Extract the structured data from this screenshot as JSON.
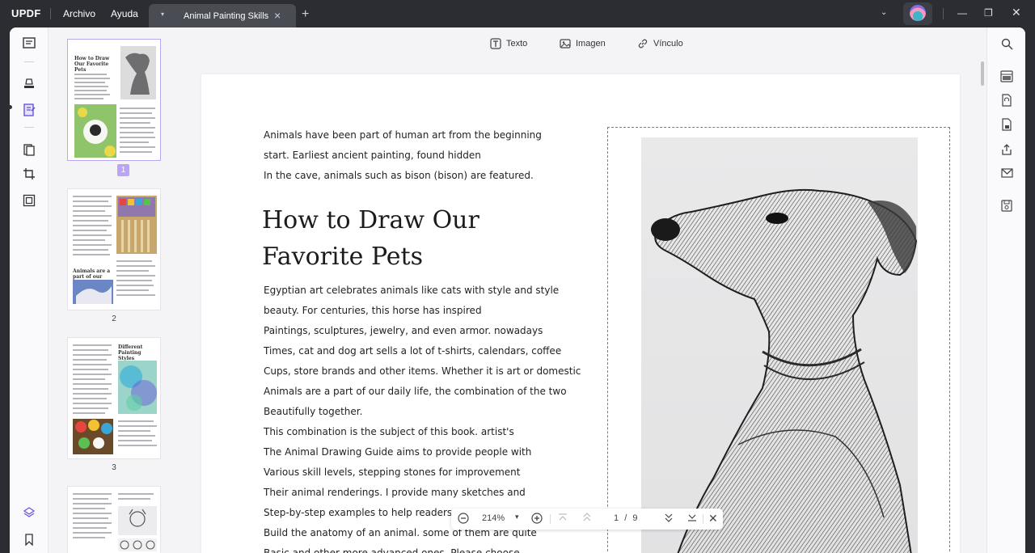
{
  "titlebar": {
    "logo": "UPDF",
    "menus": [
      "Archivo",
      "Ayuda"
    ],
    "tab_title": "Animal Painting Skills"
  },
  "toolbar": {
    "text_label": "Texto",
    "image_label": "Imagen",
    "link_label": "Vínculo"
  },
  "thumbnails": {
    "page1_heading": "How to Draw Our Favorite Pets",
    "page2_heading": "Animals are a part of our daily life",
    "page3_heading": "Different Painting Styles",
    "numbers": [
      "1",
      "2",
      "3"
    ]
  },
  "document": {
    "intro": [
      "Animals have been part of human art from the beginning",
      "start. Earliest ancient painting, found hidden",
      "In the cave, animals such as bison (bison) are featured."
    ],
    "heading_line1": "How to Draw Our",
    "heading_line2": "Favorite Pets",
    "body": [
      "Egyptian art celebrates animals like cats with style and style",
      "beauty. For centuries, this horse has inspired",
      "Paintings, sculptures, jewelry, and even armor. nowadays",
      "Times, cat and dog art sells a lot of t-shirts, calendars, coffee",
      "Cups, store brands and other items. Whether it is art or domestic",
      "Animals are a part of our daily life, the combination of the two",
      "Beautifully together.",
      "This combination is the subject of this book. artist's",
      "The Animal Drawing Guide aims to provide people with",
      "Various skill levels, stepping stones for improvement",
      "Their animal renderings. I provide many sketches and",
      "Step-by-step examples to help readers",
      "Build the anatomy of an animal. some of them are quite",
      "Basic and other more advanced ones. Please choose"
    ]
  },
  "zoom": {
    "level": "214%",
    "current_page": "1",
    "separator": "/",
    "total_pages": "9"
  }
}
